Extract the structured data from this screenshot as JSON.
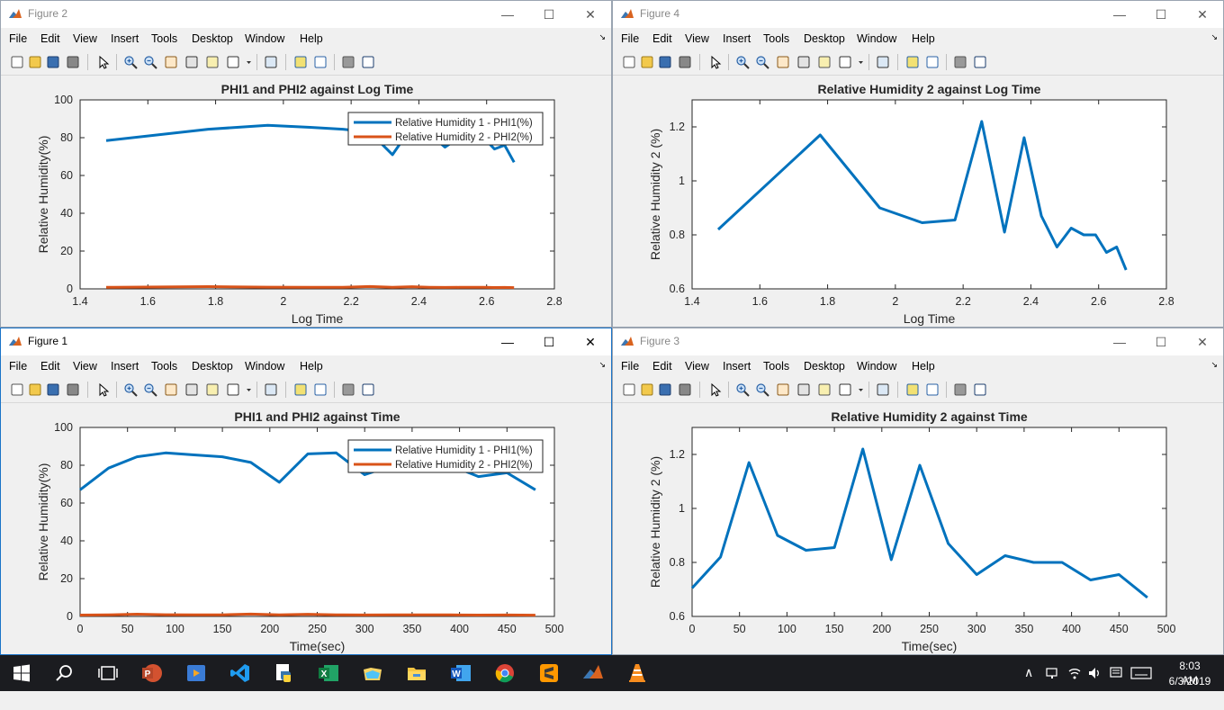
{
  "menu": [
    "File",
    "Edit",
    "View",
    "Insert",
    "Tools",
    "Desktop",
    "Window",
    "Help"
  ],
  "window_controls": {
    "minimize": "—",
    "maximize": "☐",
    "close": "✕"
  },
  "windows": [
    {
      "id": "fig2",
      "title": "Figure 2",
      "plot_title": "PHI1 and PHI2 against Log Time",
      "xlabel": "Log Time",
      "ylabel": "Relative Humidity(%)",
      "legend": [
        "Relative Humidity 1 - PHI1(%)",
        "Relative Humidity 2 - PHI2(%)"
      ]
    },
    {
      "id": "fig4",
      "title": "Figure 4",
      "plot_title": "Relative Humidity 2 against Log Time",
      "xlabel": "Log Time",
      "ylabel": "Relative Humidity 2 (%)",
      "legend": []
    },
    {
      "id": "fig1",
      "title": "Figure 1",
      "plot_title": "PHI1 and PHI2 against Time",
      "xlabel": "Time(sec)",
      "ylabel": "Relative Humidity(%)",
      "legend": [
        "Relative Humidity 1 - PHI1(%)",
        "Relative Humidity 2 - PHI2(%)"
      ]
    },
    {
      "id": "fig3",
      "title": "Figure 3",
      "plot_title": "Relative Humidity 2 against Time",
      "xlabel": "Time(sec)",
      "ylabel": "Relative Humidity 2 (%)",
      "legend": []
    }
  ],
  "chart_data": [
    {
      "type": "line",
      "title": "PHI1 and PHI2 against Log Time",
      "xlabel": "Log Time",
      "ylabel": "Relative Humidity(%)",
      "xlim": [
        1.4,
        2.8
      ],
      "ylim": [
        0,
        100
      ],
      "xticks": [
        "1.4",
        "1.6",
        "1.8",
        "2",
        "2.2",
        "2.4",
        "2.6",
        "2.8"
      ],
      "yticks": [
        "0",
        "20",
        "40",
        "60",
        "80",
        "100"
      ],
      "xticks_v": [
        1.4,
        1.6,
        1.8,
        2,
        2.2,
        2.4,
        2.6,
        2.8
      ],
      "yticks_v": [
        0,
        20,
        40,
        60,
        80,
        100
      ],
      "legend": "top-right",
      "series": [
        {
          "name": "Relative Humidity 1 - PHI1(%)",
          "color": "#0072bd",
          "x": [
            1.477,
            1.778,
            1.954,
            2.079,
            2.176,
            2.255,
            2.322,
            2.38,
            2.431,
            2.477,
            2.519,
            2.556,
            2.591,
            2.623,
            2.653,
            2.681
          ],
          "y": [
            78.5,
            84.5,
            86.5,
            85.5,
            84.5,
            83,
            71,
            86,
            82,
            75,
            80,
            78,
            80,
            74,
            76,
            67
          ]
        },
        {
          "name": "Relative Humidity 2 - PHI2(%)",
          "color": "#d95319",
          "x": [
            1.477,
            1.778,
            1.954,
            2.079,
            2.176,
            2.255,
            2.322,
            2.38,
            2.431,
            2.477,
            2.519,
            2.556,
            2.591,
            2.623,
            2.653,
            2.681
          ],
          "y": [
            0.82,
            1.17,
            0.9,
            0.845,
            0.855,
            1.22,
            0.81,
            1.16,
            0.87,
            0.755,
            0.825,
            0.8,
            0.8,
            0.735,
            0.755,
            0.67
          ]
        }
      ]
    },
    {
      "type": "line",
      "title": "Relative Humidity 2 against Log Time",
      "xlabel": "Log Time",
      "ylabel": "Relative Humidity 2 (%)",
      "xlim": [
        1.4,
        2.8
      ],
      "ylim": [
        0.6,
        1.3
      ],
      "xticks": [
        "1.4",
        "1.6",
        "1.8",
        "2",
        "2.2",
        "2.4",
        "2.6",
        "2.8"
      ],
      "yticks": [
        "0.6",
        "0.8",
        "1",
        "1.2"
      ],
      "xticks_v": [
        1.4,
        1.6,
        1.8,
        2,
        2.2,
        2.4,
        2.6,
        2.8
      ],
      "yticks_v": [
        0.6,
        0.8,
        1,
        1.2
      ],
      "series": [
        {
          "color": "#0072bd",
          "x": [
            1.477,
            1.778,
            1.954,
            2.079,
            2.176,
            2.255,
            2.322,
            2.38,
            2.431,
            2.477,
            2.519,
            2.556,
            2.591,
            2.623,
            2.653,
            2.681
          ],
          "y": [
            0.82,
            1.17,
            0.9,
            0.845,
            0.855,
            1.22,
            0.81,
            1.16,
            0.87,
            0.755,
            0.825,
            0.8,
            0.8,
            0.735,
            0.755,
            0.67
          ]
        }
      ]
    },
    {
      "type": "line",
      "title": "PHI1 and PHI2 against Time",
      "xlabel": "Time(sec)",
      "ylabel": "Relative Humidity(%)",
      "xlim": [
        0,
        500
      ],
      "ylim": [
        0,
        100
      ],
      "xticks": [
        "0",
        "50",
        "100",
        "150",
        "200",
        "250",
        "300",
        "350",
        "400",
        "450",
        "500"
      ],
      "yticks": [
        "0",
        "20",
        "40",
        "60",
        "80",
        "100"
      ],
      "xticks_v": [
        0,
        50,
        100,
        150,
        200,
        250,
        300,
        350,
        400,
        450,
        500
      ],
      "yticks_v": [
        0,
        20,
        40,
        60,
        80,
        100
      ],
      "legend": "top-right",
      "series": [
        {
          "name": "Relative Humidity 1 - PHI1(%)",
          "color": "#0072bd",
          "x": [
            0,
            30,
            60,
            90,
            120,
            150,
            180,
            210,
            240,
            270,
            300,
            330,
            360,
            390,
            420,
            450,
            480
          ],
          "y": [
            67,
            78.5,
            84.5,
            86.5,
            85.5,
            84.5,
            81.5,
            71,
            86,
            86.5,
            75,
            80,
            78,
            80,
            74,
            76,
            67
          ]
        },
        {
          "name": "Relative Humidity 2 - PHI2(%)",
          "color": "#d95319",
          "x": [
            0,
            30,
            60,
            90,
            120,
            150,
            180,
            210,
            240,
            270,
            300,
            330,
            360,
            390,
            420,
            450,
            480
          ],
          "y": [
            0.705,
            0.82,
            1.17,
            0.9,
            0.845,
            0.855,
            1.22,
            0.81,
            1.16,
            0.87,
            0.755,
            0.825,
            0.8,
            0.8,
            0.735,
            0.755,
            0.67
          ]
        }
      ]
    },
    {
      "type": "line",
      "title": "Relative Humidity 2 against Time",
      "xlabel": "Time(sec)",
      "ylabel": "Relative Humidity 2 (%)",
      "xlim": [
        0,
        500
      ],
      "ylim": [
        0.6,
        1.3
      ],
      "xticks": [
        "0",
        "50",
        "100",
        "150",
        "200",
        "250",
        "300",
        "350",
        "400",
        "450",
        "500"
      ],
      "yticks": [
        "0.6",
        "0.8",
        "1",
        "1.2"
      ],
      "xticks_v": [
        0,
        50,
        100,
        150,
        200,
        250,
        300,
        350,
        400,
        450,
        500
      ],
      "yticks_v": [
        0.6,
        0.8,
        1,
        1.2
      ],
      "series": [
        {
          "color": "#0072bd",
          "x": [
            0,
            30,
            60,
            90,
            120,
            150,
            180,
            210,
            240,
            270,
            300,
            330,
            360,
            390,
            420,
            450,
            480
          ],
          "y": [
            0.705,
            0.82,
            1.17,
            0.9,
            0.845,
            0.855,
            1.22,
            0.81,
            1.16,
            0.87,
            0.755,
            0.825,
            0.8,
            0.8,
            0.735,
            0.755,
            0.67
          ]
        }
      ]
    }
  ],
  "taskbar": {
    "clock_time": "8:03 AM",
    "clock_date": "6/3/2019",
    "apps": [
      "windows-start",
      "search",
      "task-view",
      "powerpoint",
      "video",
      "vscode",
      "python-idle",
      "excel",
      "file-viewer",
      "file-explorer",
      "word",
      "chrome",
      "sublime-text",
      "matlab",
      "vlc"
    ]
  }
}
